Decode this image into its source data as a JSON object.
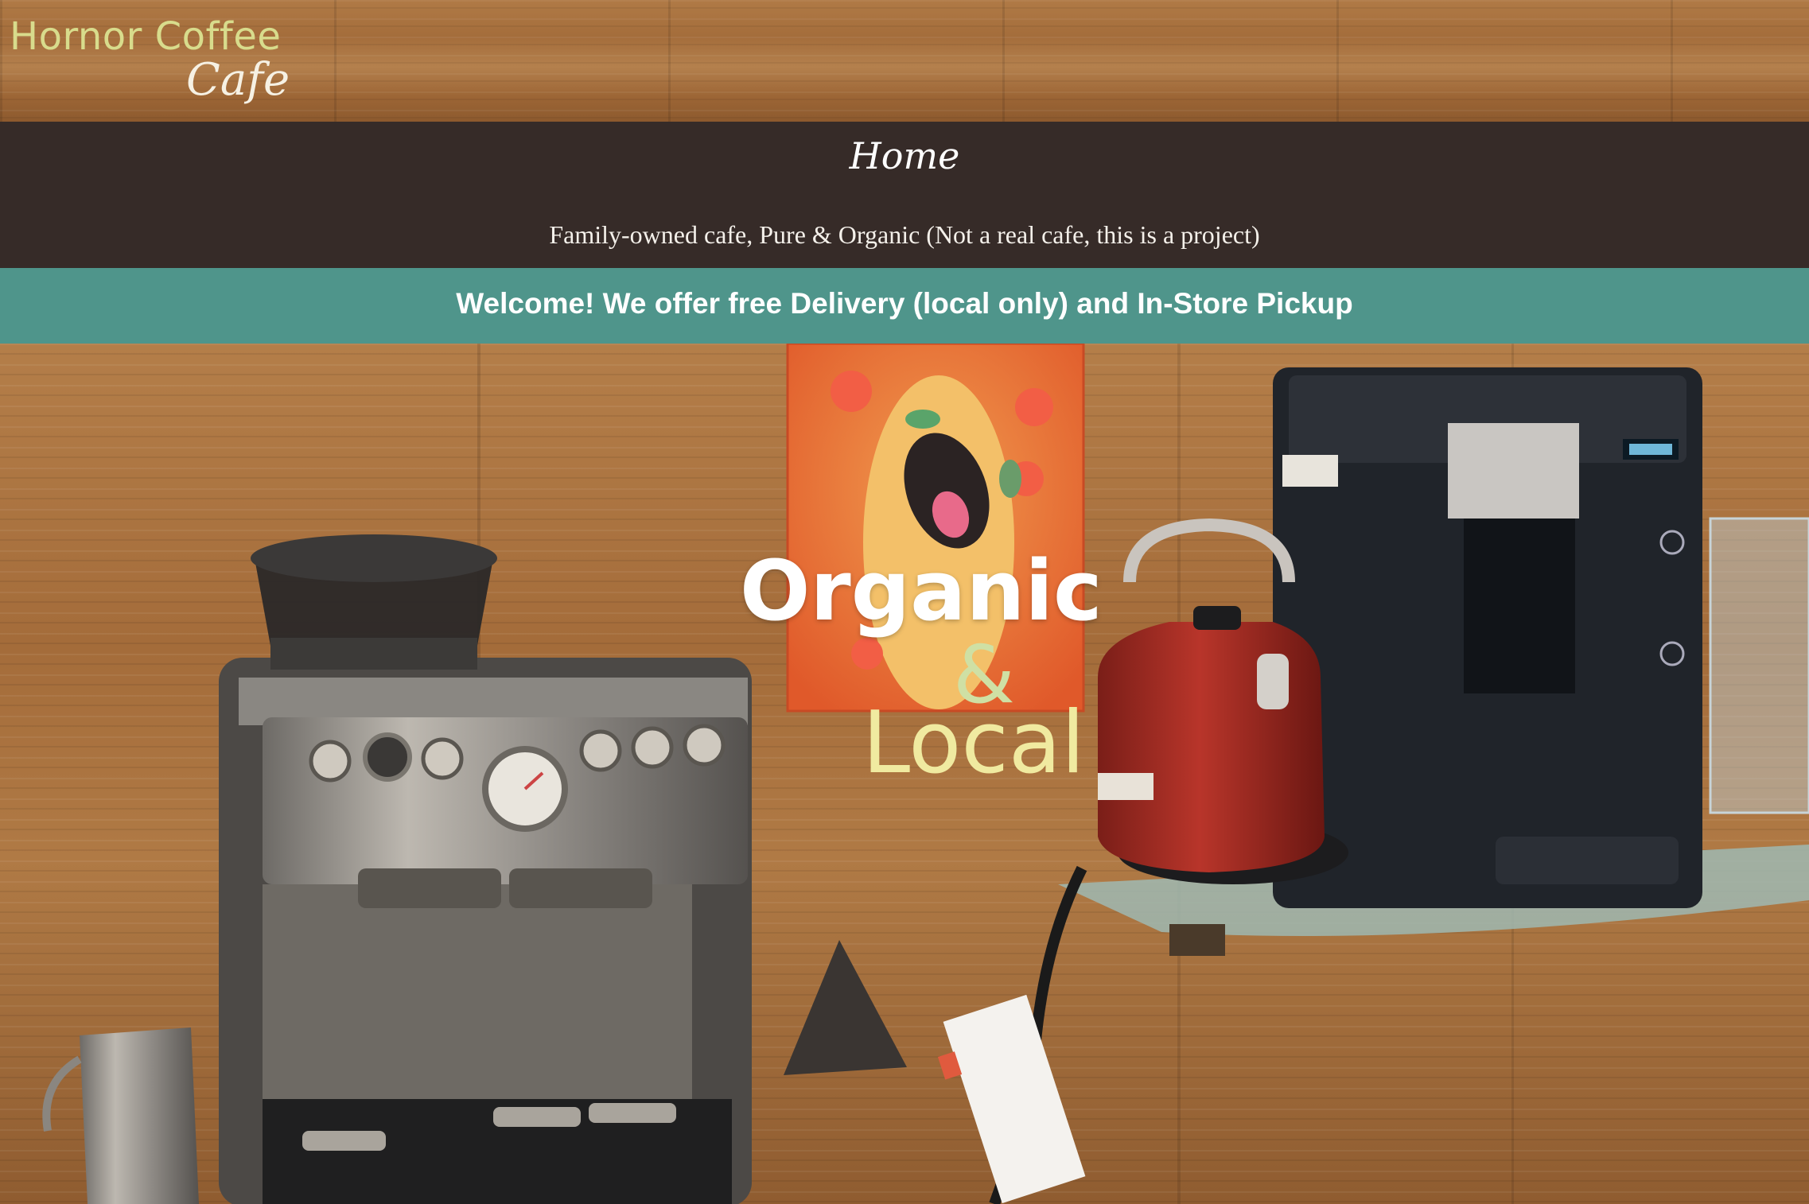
{
  "header": {
    "logo_main": "Hornor Coffee",
    "logo_sub": "Cafe"
  },
  "nav": {
    "home_label": "Home",
    "tagline": "Family-owned cafe, Pure & Organic (Not a real cafe, this is a project)"
  },
  "banner": {
    "text": "Welcome! We offer free Delivery (local only) and In-Store Pickup"
  },
  "hero": {
    "line1": "Organic",
    "amp": "&",
    "line3": "Local",
    "image_alt": "coffee-station-photo"
  },
  "colors": {
    "nav_band": "#362b28",
    "banner": "#4f958b",
    "logo_main": "#d8dc8c",
    "hero_amp": "#cfe0a4",
    "hero_local": "#f0eaa0"
  }
}
